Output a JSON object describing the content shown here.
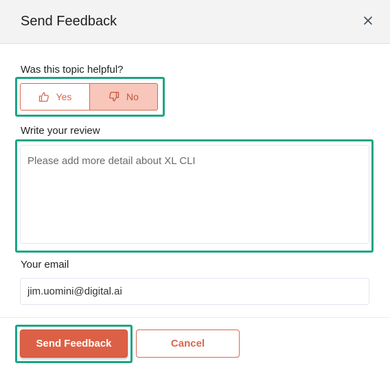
{
  "dialog": {
    "title": "Send Feedback",
    "close_icon": "close-icon"
  },
  "helpful": {
    "label": "Was this topic helpful?",
    "yes_label": "Yes",
    "no_label": "No",
    "yes_icon": "thumbs-up-icon",
    "no_icon": "thumbs-down-icon",
    "selected": "No"
  },
  "review": {
    "label": "Write your review",
    "placeholder": "Please add more detail about XL CLI",
    "value": ""
  },
  "email": {
    "label": "Your email",
    "value": "jim.uomini@digital.ai"
  },
  "actions": {
    "send_label": "Send Feedback",
    "cancel_label": "Cancel"
  },
  "colors": {
    "accent": "#dc6045",
    "selected_bg": "#f8c6ba",
    "highlight": "#1aa583"
  }
}
